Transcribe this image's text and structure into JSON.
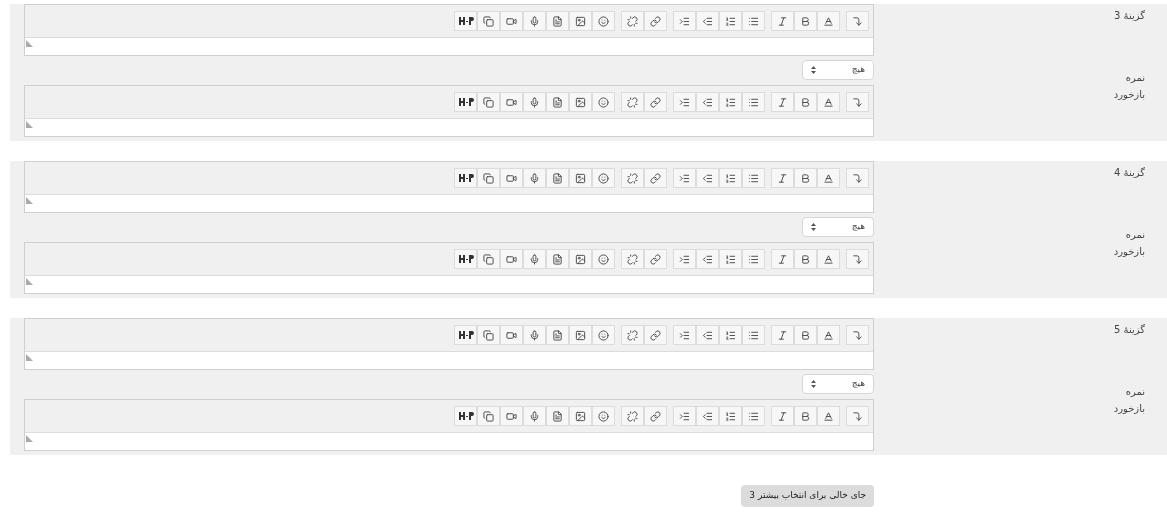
{
  "choices": [
    {
      "label": "گزینهٔ 3",
      "grade_label": "نمره",
      "grade_value": "هیچ",
      "feedback_label": "بازخورد"
    },
    {
      "label": "گزینهٔ 4",
      "grade_label": "نمره",
      "grade_value": "هیچ",
      "feedback_label": "بازخورد"
    },
    {
      "label": "گزینهٔ 5",
      "grade_label": "نمره",
      "grade_value": "هیچ",
      "feedback_label": "بازخورد"
    }
  ],
  "add_button": "3 جای خالی برای انتخاب بیشتر"
}
